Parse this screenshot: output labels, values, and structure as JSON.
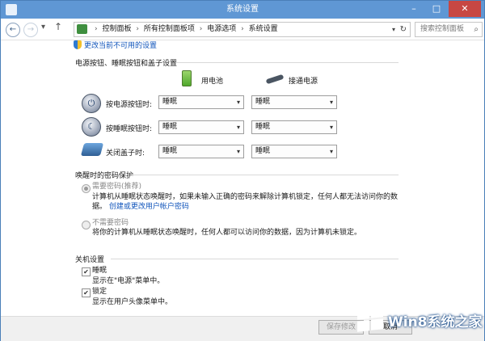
{
  "window": {
    "title": "系统设置"
  },
  "titlebar": {
    "min_icon": "–",
    "max_icon": "□",
    "close_icon": "✕"
  },
  "nav": {
    "back_icon": "←",
    "forward_icon": "→",
    "dropdown_icon": "▾",
    "up_icon": "↑",
    "breadcrumbs": [
      "控制面板",
      "所有控制面板项",
      "电源选项",
      "系统设置"
    ],
    "separator": "›",
    "address_dropdown_icon": "▾",
    "refresh_icon": "↻",
    "search_placeholder": "搜索控制面板",
    "search_icon": "⌕"
  },
  "admin_link": "更改当前不可用的设置",
  "power": {
    "heading": "电源按钮、睡眠按钮和盖子设置",
    "battery_label": "用电池",
    "plugged_label": "接通电源",
    "rows": [
      {
        "label": "按电源按钮时:",
        "icon": "power-icon",
        "glyph": "⏻",
        "battery": "睡眠",
        "plugged": "睡眠"
      },
      {
        "label": "按睡眠按钮时:",
        "icon": "sleep-icon",
        "glyph": "☾",
        "battery": "睡眠",
        "plugged": "睡眠"
      },
      {
        "label": "关闭盖子时:",
        "icon": "laptop-lid-icon",
        "glyph": "",
        "battery": "睡眠",
        "plugged": "睡眠"
      }
    ],
    "arrow_icon": "▾"
  },
  "wake": {
    "heading": "唤醒时的密码保护",
    "option1": {
      "label": "需要密码(推荐)",
      "desc1": "计算机从睡眠状态唤醒时，如果未输入正确的密码来解除计算机锁定，任何人都无法访问你的数",
      "desc2": "据。",
      "link": "创建或更改用户帐户密码"
    },
    "option2": {
      "label": "不需要密码",
      "desc": "将你的计算机从睡眠状态唤醒时，任何人都可以访问你的数据，因为计算机未锁定。"
    }
  },
  "shutdown": {
    "heading": "关机设置",
    "items": [
      {
        "label": "睡眠",
        "desc": "显示在\"电源\"菜单中。",
        "checked": "✔"
      },
      {
        "label": "锁定",
        "desc": "显示在用户头像菜单中。",
        "checked": "✔"
      }
    ]
  },
  "footer": {
    "save": "保存修改",
    "cancel": "取消"
  },
  "watermark": {
    "text": "Win8系统之家"
  },
  "colors": {
    "titlebar": "#5f97d4",
    "close": "#c74743",
    "link": "#1155bb"
  }
}
